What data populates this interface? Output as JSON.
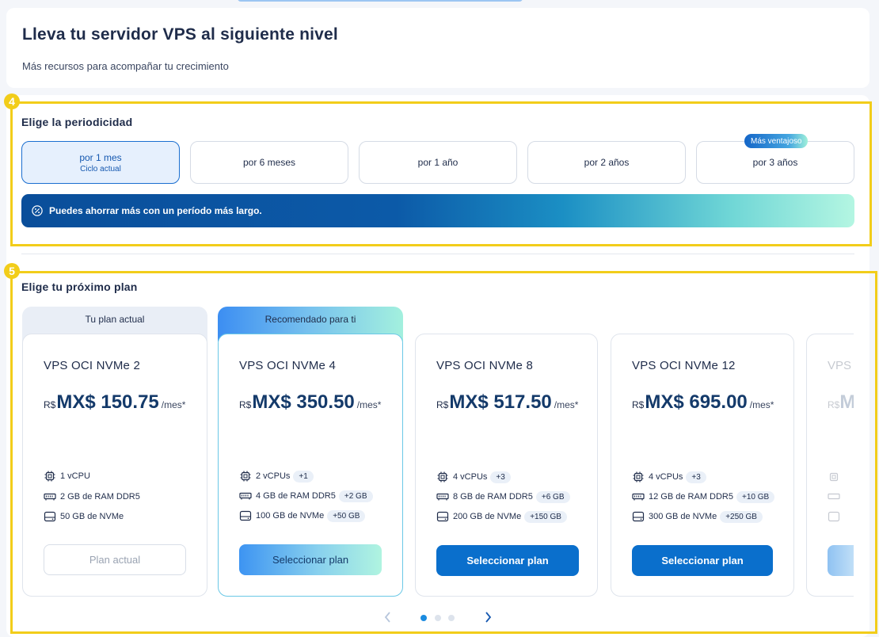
{
  "header": {
    "title": "Lleva tu servidor VPS al siguiente nivel",
    "subtitle": "Más recursos para acompañar tu crecimiento"
  },
  "annotations": [
    "4",
    "5"
  ],
  "periodicity": {
    "title": "Elige la periodicidad",
    "options": [
      {
        "label": "por 1 mes",
        "sub": "Ciclo actual",
        "active": true
      },
      {
        "label": "por 6 meses"
      },
      {
        "label": "por 1 año"
      },
      {
        "label": "por 2 años"
      },
      {
        "label": "por 3 años",
        "badge": "Más ventajoso"
      }
    ],
    "banner": "Puedes ahorrar más con un período más largo."
  },
  "plans": {
    "title": "Elige tu próximo plan",
    "cards": [
      {
        "tag": "Tu plan actual",
        "name": "VPS OCI NVMe 2",
        "currency": "R$",
        "price": "MX$ 150.75",
        "per": "/mes*",
        "specs": [
          {
            "icon": "cpu-icon",
            "text": "1 vCPU",
            "extra": ""
          },
          {
            "icon": "ram-icon",
            "text": "2 GB de RAM DDR5",
            "extra": ""
          },
          {
            "icon": "storage-icon",
            "text": "50 GB de NVMe",
            "extra": ""
          }
        ],
        "button": "Plan actual"
      },
      {
        "tag": "Recomendado para ti",
        "name": "VPS OCI NVMe 4",
        "currency": "R$",
        "price": "MX$ 350.50",
        "per": "/mes*",
        "specs": [
          {
            "icon": "cpu-icon",
            "text": "2 vCPUs",
            "extra": "+1"
          },
          {
            "icon": "ram-icon",
            "text": "4 GB de RAM DDR5",
            "extra": "+2 GB"
          },
          {
            "icon": "storage-icon",
            "text": "100 GB de NVMe",
            "extra": "+50 GB"
          }
        ],
        "button": "Seleccionar plan"
      },
      {
        "name": "VPS OCI NVMe 8",
        "currency": "R$",
        "price": "MX$ 517.50",
        "per": "/mes*",
        "specs": [
          {
            "icon": "cpu-icon",
            "text": "4 vCPUs",
            "extra": "+3"
          },
          {
            "icon": "ram-icon",
            "text": "8 GB de RAM DDR5",
            "extra": "+6 GB"
          },
          {
            "icon": "storage-icon",
            "text": "200 GB de NVMe",
            "extra": "+150 GB"
          }
        ],
        "button": "Seleccionar plan"
      },
      {
        "name": "VPS OCI NVMe 12",
        "currency": "R$",
        "price": "MX$ 695.00",
        "per": "/mes*",
        "specs": [
          {
            "icon": "cpu-icon",
            "text": "4 vCPUs",
            "extra": "+3"
          },
          {
            "icon": "ram-icon",
            "text": "12 GB de RAM DDR5",
            "extra": "+10 GB"
          },
          {
            "icon": "storage-icon",
            "text": "300 GB de NVMe",
            "extra": "+250 GB"
          }
        ],
        "button": "Seleccionar plan"
      },
      {
        "partial_name": "VPS",
        "currency": "R$",
        "partial_price": "M"
      }
    ],
    "carousel": {
      "pages": 3,
      "active_page": 1
    }
  },
  "colors": {
    "highlight": "#f2cd1a",
    "primary": "#0a6fcc",
    "price": "#143a6a"
  }
}
